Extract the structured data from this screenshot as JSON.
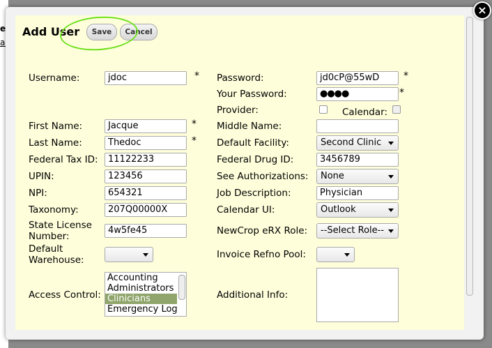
{
  "background": {
    "fragment_1": "e",
    "fragment_2": "al"
  },
  "close_label": "×",
  "title": "Add User",
  "buttons": {
    "save": "Save",
    "cancel": "Cancel"
  },
  "fields": {
    "username": {
      "label": "Username:",
      "value": "jdoc"
    },
    "password": {
      "label": "Password:",
      "value": "jd0cP@55wD"
    },
    "your_password": {
      "label": "Your Password:",
      "value": "●●●●"
    },
    "provider": {
      "label": "Provider:"
    },
    "calendar": {
      "label": "Calendar:"
    },
    "first_name": {
      "label": "First Name:",
      "value": "Jacque"
    },
    "middle_name": {
      "label": "Middle Name:",
      "value": ""
    },
    "last_name": {
      "label": "Last Name:",
      "value": "Thedoc"
    },
    "default_facility": {
      "label": "Default Facility:",
      "value": "Second Clinic"
    },
    "federal_tax_id": {
      "label": "Federal Tax ID:",
      "value": "11122233"
    },
    "federal_drug_id": {
      "label": "Federal Drug ID:",
      "value": "3456789"
    },
    "upin": {
      "label": "UPIN:",
      "value": "123456"
    },
    "see_authorizations": {
      "label": "See Authorizations:",
      "value": "None"
    },
    "npi": {
      "label": "NPI:",
      "value": "654321"
    },
    "job_description": {
      "label": "Job Description:",
      "value": "Physician"
    },
    "taxonomy": {
      "label": "Taxonomy:",
      "value": "207Q00000X"
    },
    "calendar_ui": {
      "label": "Calendar UI:",
      "value": "Outlook"
    },
    "state_license_1": "State License",
    "state_license_2": "Number:",
    "state_license_value": "4w5fe45",
    "newcrop_role": {
      "label": "NewCrop eRX Role:",
      "value": "--Select Role--"
    },
    "default_warehouse_1": "Default",
    "default_warehouse_2": "Warehouse:",
    "default_warehouse_value": "",
    "invoice_refno_pool": {
      "label": "Invoice Refno Pool:",
      "value": ""
    },
    "access_control": {
      "label": "Access Control:",
      "options": [
        "Accounting",
        "Administrators",
        "Clinicians",
        "Emergency Login"
      ],
      "selected": "Clinicians"
    },
    "additional_info": {
      "label": "Additional Info:",
      "value": ""
    }
  },
  "required_mark": "*",
  "colors": {
    "panel": "#fefedb",
    "highlight": "#6ee01e",
    "selected_option": "#8fa56b"
  }
}
